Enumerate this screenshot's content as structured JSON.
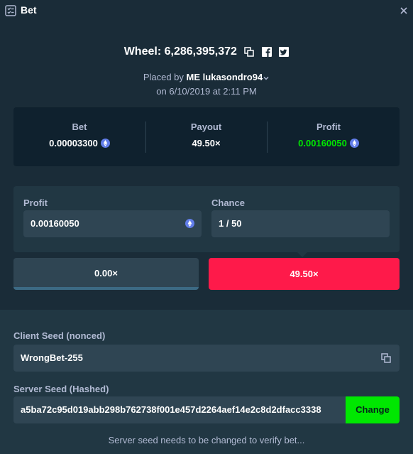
{
  "header": {
    "title": "Bet",
    "icon": "ticket-icon",
    "close_icon": "close-icon"
  },
  "wheel": {
    "title": "Wheel: 6,286,395,372",
    "icons": [
      "copy-icon",
      "facebook-icon",
      "twitter-icon"
    ]
  },
  "placed": {
    "prefix": "Placed by",
    "tag": "ME",
    "user": "lukasondro94",
    "date": "on 6/10/2019 at 2:11 PM"
  },
  "summary": {
    "bet_label": "Bet",
    "bet_value": "0.00003300",
    "payout_label": "Payout",
    "payout_value": "49.50×",
    "profit_label": "Profit",
    "profit_value": "0.00160050"
  },
  "calc": {
    "profit_label": "Profit",
    "profit_value": "0.00160050",
    "chance_label": "Chance",
    "chance_value": "1 / 50"
  },
  "multipliers": {
    "left": "0.00×",
    "right": "49.50×"
  },
  "fairness": {
    "client_seed_label": "Client Seed (nonced)",
    "client_seed_value": "WrongBet-255",
    "server_seed_label": "Server Seed (Hashed)",
    "server_seed_value": "a5ba72c95d019abb298b762738f001e457d2264aef14e2c8d2dfacc3338",
    "change_label": "Change",
    "note": "Server seed needs to be changed to verify bet..."
  },
  "colors": {
    "background": "#1a2c38",
    "panel_dark": "#0f212e",
    "panel": "#213743",
    "input": "#2f4553",
    "accent_red": "#fe1a4a",
    "accent_green": "#00e701",
    "eth": "#627eea"
  }
}
